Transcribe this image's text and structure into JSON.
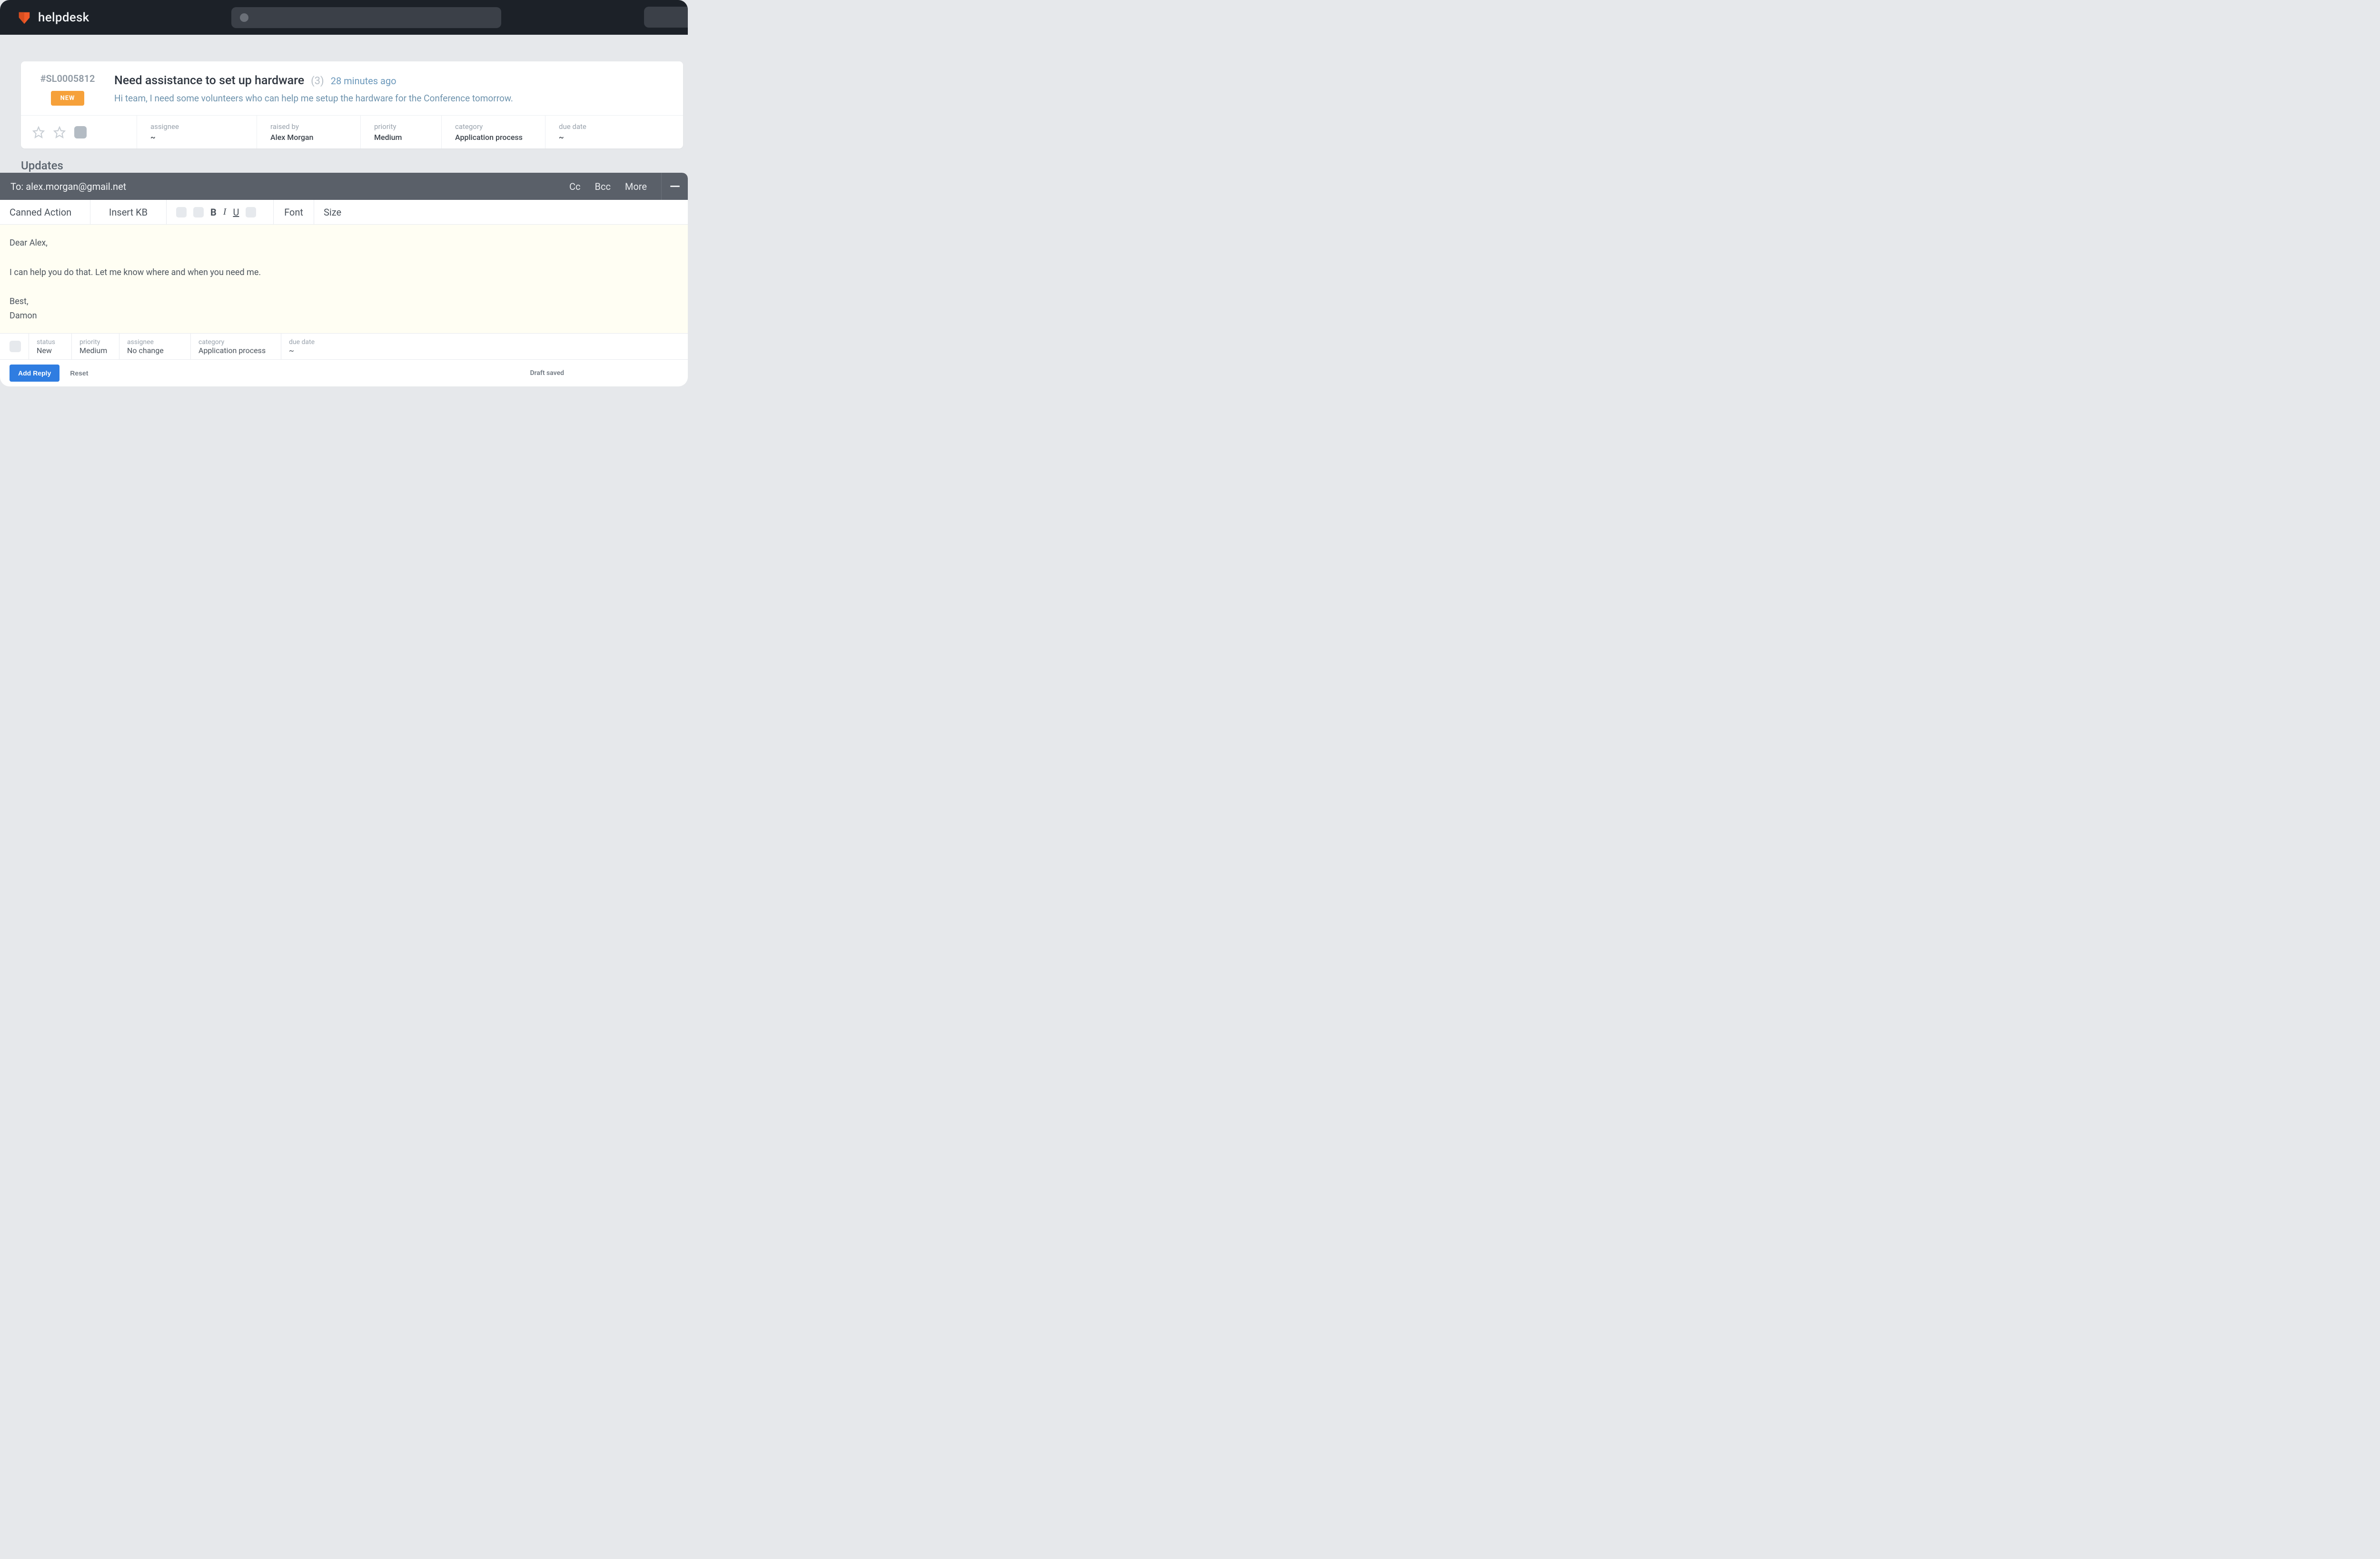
{
  "brand": {
    "name": "helpdesk"
  },
  "ticket": {
    "id": "#SL0005812",
    "badge": "NEW",
    "title": "Need assistance to set up hardware",
    "count": "(3)",
    "time": "28 minutes ago",
    "description": "Hi team, I need some volunteers who can help me setup the hardware for the Conference tomorrow.",
    "meta": {
      "assignee": {
        "label": "assignee",
        "value": "~"
      },
      "raised_by": {
        "label": "raised by",
        "value": "Alex Morgan"
      },
      "priority": {
        "label": "priority",
        "value": "Medium"
      },
      "category": {
        "label": "category",
        "value": "Application process"
      },
      "due_date": {
        "label": "due date",
        "value": "~"
      }
    }
  },
  "updates": {
    "title": "Updates"
  },
  "compose": {
    "to_label": "To:",
    "to_value": "alex.morgan@gmail.net",
    "cc": "Cc",
    "bcc": "Bcc",
    "more": "More",
    "toolbar": {
      "canned_action": "Canned Action",
      "insert_kb": "Insert KB",
      "bold": "B",
      "italic": "I",
      "underline": "U",
      "font": "Font",
      "size": "Size"
    },
    "body": "Dear Alex,\n\nI can help you do that. Let me know where and when you need me.\n\nBest,\nDamon",
    "meta": {
      "status": {
        "label": "status",
        "value": "New"
      },
      "priority": {
        "label": "priority",
        "value": "Medium"
      },
      "assignee": {
        "label": "assignee",
        "value": "No change"
      },
      "category": {
        "label": "category",
        "value": "Application process"
      },
      "due_date": {
        "label": "due date",
        "value": "~"
      }
    },
    "footer": {
      "add_reply": "Add Reply",
      "reset": "Reset",
      "draft_saved": "Draft saved"
    }
  }
}
